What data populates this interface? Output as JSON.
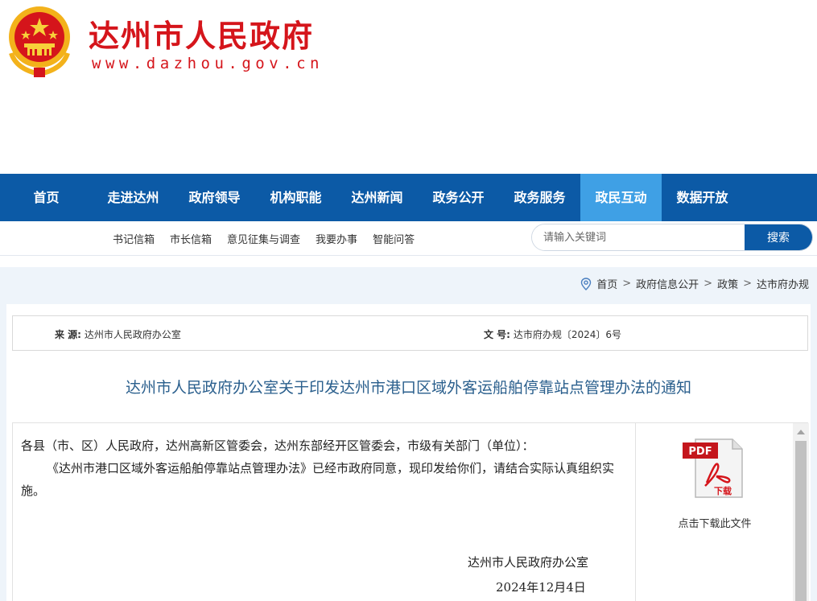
{
  "header": {
    "site_title": "达州市人民政府",
    "site_url": "www.dazhou.gov.cn"
  },
  "nav": {
    "items": [
      {
        "label": "首页"
      },
      {
        "label": "走进达州"
      },
      {
        "label": "政府领导"
      },
      {
        "label": "机构职能"
      },
      {
        "label": "达州新闻"
      },
      {
        "label": "政务公开"
      },
      {
        "label": "政务服务"
      },
      {
        "label": "政民互动",
        "active": true
      },
      {
        "label": "数据开放"
      }
    ]
  },
  "subnav": {
    "links": [
      "书记信箱",
      "市长信箱",
      "意见征集与调查",
      "我要办事",
      "智能问答"
    ]
  },
  "search": {
    "placeholder": "请输入关键词",
    "button_label": "搜索"
  },
  "breadcrumb": {
    "items": [
      "首页",
      "政府信息公开",
      "政策",
      "达市府办规"
    ],
    "separator": ">"
  },
  "meta": {
    "source_key": "来 源:",
    "source_value": "达州市人民政府办公室",
    "docno_key": "文 号:",
    "docno_value": "达市府办规〔2024〕6号"
  },
  "document": {
    "title": "达州市人民政府办公室关于印发达州市港口区域外客运船舶停靠站点管理办法的通知",
    "salutation": "各县（市、区）人民政府，达州高新区管委会，达州东部经开区管委会，市级有关部门（单位）：",
    "paragraph": "《达州市港口区域外客运船舶停靠站点管理办法》已经市政府同意，现印发给你们，请结合实际认真组织实施。",
    "signature_org": "达州市人民政府办公室",
    "signature_date": "2024年12月4日"
  },
  "download": {
    "icon_text": "PDF",
    "icon_sub": "下载",
    "label": "点击下载此文件"
  },
  "colors": {
    "brand_red": "#d5151b",
    "nav_blue": "#0c5aa6",
    "nav_active": "#3fa0e5",
    "title_blue": "#2a5f8d"
  }
}
